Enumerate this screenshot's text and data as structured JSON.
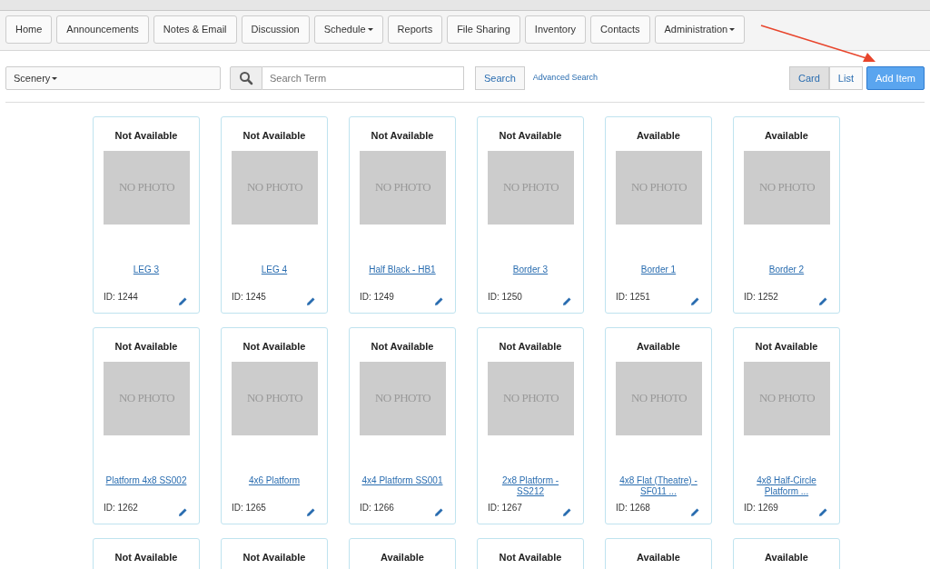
{
  "nav": [
    {
      "label": "Home",
      "dropdown": false
    },
    {
      "label": "Announcements",
      "dropdown": false
    },
    {
      "label": "Notes & Email",
      "dropdown": false
    },
    {
      "label": "Discussion",
      "dropdown": false
    },
    {
      "label": "Schedule",
      "dropdown": true
    },
    {
      "label": "Reports",
      "dropdown": false
    },
    {
      "label": "File Sharing",
      "dropdown": false
    },
    {
      "label": "Inventory",
      "dropdown": false
    },
    {
      "label": "Contacts",
      "dropdown": false
    },
    {
      "label": "Administration",
      "dropdown": true
    }
  ],
  "category": {
    "value": "Scenery"
  },
  "search": {
    "placeholder": "Search Term",
    "button": "Search",
    "advanced": "Advanced Search"
  },
  "views": [
    {
      "label": "Card",
      "selected": true
    },
    {
      "label": "List",
      "selected": false
    }
  ],
  "add_button": "Add Item",
  "items": [
    {
      "status": "Not Available",
      "photo": "NO PHOTO",
      "name": "LEG 3",
      "id": "ID: 1244"
    },
    {
      "status": "Not Available",
      "photo": "NO PHOTO",
      "name": "LEG 4",
      "id": "ID: 1245"
    },
    {
      "status": "Not Available",
      "photo": "NO PHOTO",
      "name": "Half Black - HB1",
      "id": "ID: 1249"
    },
    {
      "status": "Not Available",
      "photo": "NO PHOTO",
      "name": "Border 3",
      "id": "ID: 1250"
    },
    {
      "status": "Available",
      "photo": "NO PHOTO",
      "name": "Border 1",
      "id": "ID: 1251"
    },
    {
      "status": "Available",
      "photo": "NO PHOTO",
      "name": "Border 2",
      "id": "ID: 1252"
    },
    {
      "status": "Not Available",
      "photo": "NO PHOTO",
      "name": "Platform 4x8 SS002",
      "id": "ID: 1262"
    },
    {
      "status": "Not Available",
      "photo": "NO PHOTO",
      "name": "4x6 Platform",
      "id": "ID: 1265"
    },
    {
      "status": "Not Available",
      "photo": "NO PHOTO",
      "name": "4x4 Platform SS001",
      "id": "ID: 1266"
    },
    {
      "status": "Not Available",
      "photo": "NO PHOTO",
      "name": "2x8 Platform - SS212",
      "id": "ID: 1267"
    },
    {
      "status": "Available",
      "photo": "NO PHOTO",
      "name": "4x8 Flat (Theatre) - SF011 ...",
      "id": "ID: 1268"
    },
    {
      "status": "Not Available",
      "photo": "NO PHOTO",
      "name": "4x8 Half-Circle Platform ...",
      "id": "ID: 1269"
    },
    {
      "status": "Not Available"
    },
    {
      "status": "Not Available"
    },
    {
      "status": "Available"
    },
    {
      "status": "Not Available"
    },
    {
      "status": "Available"
    },
    {
      "status": "Available"
    }
  ]
}
